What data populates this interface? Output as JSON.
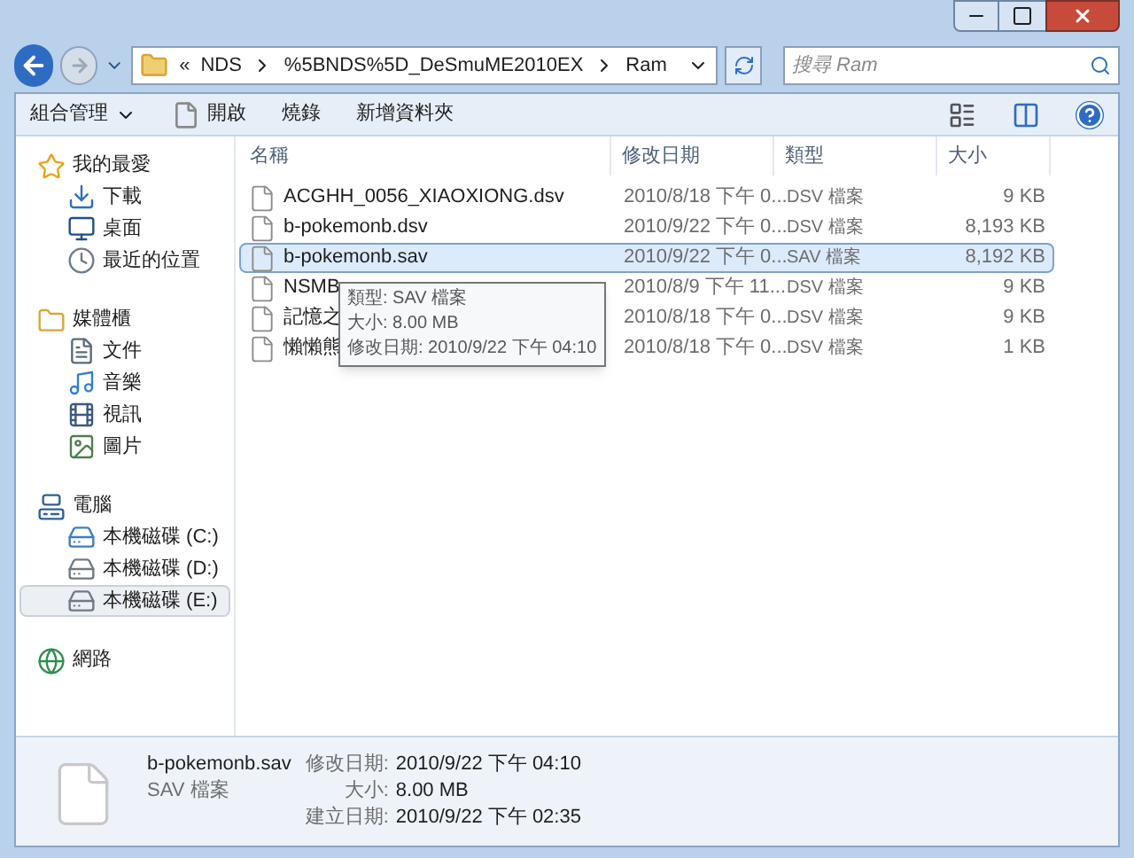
{
  "address_bar": {
    "segments": [
      "«",
      "NDS",
      "%5BNDS%5D_DeSmuME2010EX",
      "Ram"
    ]
  },
  "search": {
    "placeholder": "搜尋 Ram"
  },
  "toolbar": {
    "items": [
      "組合管理",
      "開啟",
      "燒錄",
      "新增資料夾"
    ]
  },
  "sidebar": {
    "groups": [
      {
        "label": "我的最愛",
        "kind": "favorites",
        "children": [
          {
            "label": "下載",
            "kind": "download",
            "selected": false
          },
          {
            "label": "桌面",
            "kind": "desktop",
            "selected": false
          },
          {
            "label": "最近的位置",
            "kind": "recent",
            "selected": false
          }
        ]
      },
      {
        "label": "媒體櫃",
        "kind": "library",
        "children": [
          {
            "label": "文件",
            "kind": "doc",
            "selected": false
          },
          {
            "label": "音樂",
            "kind": "music",
            "selected": false
          },
          {
            "label": "視訊",
            "kind": "video",
            "selected": false
          },
          {
            "label": "圖片",
            "kind": "image",
            "selected": false
          }
        ]
      },
      {
        "label": "電腦",
        "kind": "computer",
        "children": [
          {
            "label": "本機磁碟 (C:)",
            "kind": "sysdrive",
            "selected": false
          },
          {
            "label": "本機磁碟 (D:)",
            "kind": "drive",
            "selected": false
          },
          {
            "label": "本機磁碟 (E:)",
            "kind": "drive",
            "selected": true
          }
        ]
      },
      {
        "label": "網路",
        "kind": "network"
      }
    ]
  },
  "table": {
    "columns": [
      "名稱",
      "修改日期",
      "類型",
      "大小"
    ],
    "rows": [
      {
        "name": "ACGHH_0056_XIAOXIONG.dsv",
        "date": "2010/8/18 下午 0...",
        "type": "DSV 檔案",
        "size": "9 KB",
        "selected": false
      },
      {
        "name": "b-pokemonb.dsv",
        "date": "2010/9/22 下午 0...",
        "type": "DSV 檔案",
        "size": "8,193 KB",
        "selected": false
      },
      {
        "name": "b-pokemonb.sav",
        "date": "2010/9/22 下午 0...",
        "type": "SAV 檔案",
        "size": "8,192 KB",
        "selected": true
      },
      {
        "name": "NSMB",
        "date": "2010/8/9 下午 11...",
        "type": "DSV 檔案",
        "size": "9 KB",
        "selected": false
      },
      {
        "name": "記憶之",
        "date": "2010/8/18 下午 0...",
        "type": "DSV 檔案",
        "size": "9 KB",
        "selected": false
      },
      {
        "name": "懶懶熊",
        "date": "2010/8/18 下午 0...",
        "type": "DSV 檔案",
        "size": "1 KB",
        "selected": false
      }
    ]
  },
  "tooltip": {
    "lines": [
      "類型: SAV 檔案",
      "大小: 8.00 MB",
      "修改日期: 2010/9/22 下午 04:10"
    ]
  },
  "details": {
    "name": "b-pokemonb.sav",
    "type": "SAV 檔案",
    "fields": [
      {
        "label": "修改日期:",
        "value": "2010/9/22 下午 04:10"
      },
      {
        "label": "大小:",
        "value": "8.00 MB"
      },
      {
        "label": "建立日期:",
        "value": "2010/9/22 下午 02:35"
      }
    ]
  }
}
